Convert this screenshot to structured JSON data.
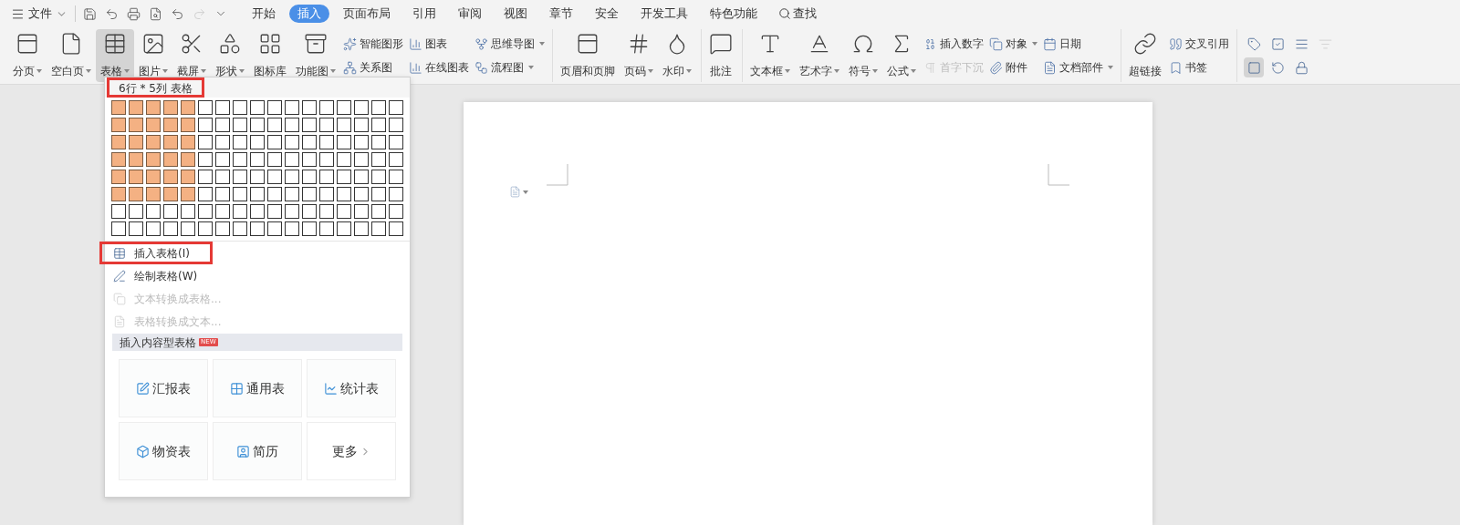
{
  "menu": {
    "file": "文件",
    "tabs": [
      {
        "label": "开始",
        "selected": false
      },
      {
        "label": "插入",
        "selected": true
      },
      {
        "label": "页面布局",
        "selected": false
      },
      {
        "label": "引用",
        "selected": false
      },
      {
        "label": "审阅",
        "selected": false
      },
      {
        "label": "视图",
        "selected": false
      },
      {
        "label": "章节",
        "selected": false
      },
      {
        "label": "安全",
        "selected": false
      },
      {
        "label": "开发工具",
        "selected": false
      },
      {
        "label": "特色功能",
        "selected": false
      }
    ],
    "search": "查找"
  },
  "ribbon": {
    "groups": [
      {
        "items": [
          {
            "kind": "large",
            "label": "分页",
            "dropdown": true,
            "selected": false
          },
          {
            "kind": "large",
            "label": "空白页",
            "dropdown": true,
            "selected": false
          },
          {
            "kind": "large",
            "label": "表格",
            "dropdown": true,
            "selected": true
          },
          {
            "kind": "large",
            "label": "图片",
            "dropdown": true,
            "selected": false
          },
          {
            "kind": "large",
            "label": "截屏",
            "dropdown": true,
            "selected": false
          },
          {
            "kind": "large",
            "label": "形状",
            "dropdown": true,
            "selected": false
          },
          {
            "kind": "large",
            "label": "图标库",
            "dropdown": false,
            "selected": false
          },
          {
            "kind": "large",
            "label": "功能图",
            "dropdown": true,
            "selected": false
          },
          {
            "kind": "stack",
            "buttons": [
              {
                "label": "智能图形",
                "dropdown": false,
                "disabled": false
              },
              {
                "label": "关系图",
                "dropdown": false,
                "disabled": false
              }
            ]
          },
          {
            "kind": "stack",
            "buttons": [
              {
                "label": "图表",
                "dropdown": false,
                "disabled": false
              },
              {
                "label": "在线图表",
                "dropdown": false,
                "disabled": false
              }
            ]
          },
          {
            "kind": "stack",
            "buttons": [
              {
                "label": "思维导图",
                "dropdown": true,
                "disabled": false
              },
              {
                "label": "流程图",
                "dropdown": true,
                "disabled": false
              }
            ]
          }
        ]
      },
      {
        "items": [
          {
            "kind": "large",
            "label": "页眉和页脚",
            "dropdown": false,
            "selected": false
          },
          {
            "kind": "large",
            "label": "页码",
            "dropdown": true,
            "selected": false
          },
          {
            "kind": "large",
            "label": "水印",
            "dropdown": true,
            "selected": false
          }
        ]
      },
      {
        "items": [
          {
            "kind": "large",
            "label": "批注",
            "dropdown": false,
            "selected": false
          }
        ]
      },
      {
        "items": [
          {
            "kind": "large",
            "label": "文本框",
            "dropdown": true,
            "selected": false
          },
          {
            "kind": "large",
            "label": "艺术字",
            "dropdown": true,
            "selected": false
          },
          {
            "kind": "large",
            "label": "符号",
            "dropdown": true,
            "selected": false
          },
          {
            "kind": "large",
            "label": "公式",
            "dropdown": true,
            "selected": false
          },
          {
            "kind": "stack",
            "buttons": [
              {
                "label": "插入数字",
                "dropdown": false,
                "disabled": false
              },
              {
                "label": "首字下沉",
                "dropdown": false,
                "disabled": true
              }
            ]
          },
          {
            "kind": "stack",
            "buttons": [
              {
                "label": "对象",
                "dropdown": true,
                "disabled": false
              },
              {
                "label": "附件",
                "dropdown": false,
                "disabled": false
              }
            ]
          },
          {
            "kind": "stack",
            "buttons": [
              {
                "label": "日期",
                "dropdown": false,
                "disabled": false
              },
              {
                "label": "文档部件",
                "dropdown": true,
                "disabled": false
              }
            ]
          }
        ]
      },
      {
        "items": [
          {
            "kind": "large",
            "label": "超链接",
            "dropdown": false,
            "selected": false
          },
          {
            "kind": "stack",
            "buttons": [
              {
                "label": "交叉引用",
                "dropdown": false,
                "disabled": false
              },
              {
                "label": "书签",
                "dropdown": false,
                "disabled": false
              }
            ]
          }
        ]
      },
      {
        "items": [
          {
            "kind": "icon_grid",
            "rows": [
              [
                {
                  "selected": false,
                  "disabled": false
                },
                {
                  "selected": false,
                  "disabled": false
                },
                {
                  "selected": false,
                  "disabled": false
                },
                {
                  "selected": false,
                  "disabled": true
                }
              ],
              [
                {
                  "selected": true,
                  "disabled": false
                },
                {
                  "selected": false,
                  "disabled": false
                },
                {
                  "selected": false,
                  "disabled": false
                }
              ]
            ]
          }
        ]
      }
    ]
  },
  "table_menu": {
    "size_label": {
      "text": "6行 * 5列 表格",
      "highlighted": true
    },
    "grid": [
      {
        "cells": [
          {
            "selected": true
          },
          {
            "selected": true
          },
          {
            "selected": true
          },
          {
            "selected": true
          },
          {
            "selected": true
          },
          {
            "selected": false
          },
          {
            "selected": false
          },
          {
            "selected": false
          },
          {
            "selected": false
          },
          {
            "selected": false
          },
          {
            "selected": false
          },
          {
            "selected": false
          },
          {
            "selected": false
          },
          {
            "selected": false
          },
          {
            "selected": false
          },
          {
            "selected": false
          },
          {
            "selected": false
          }
        ]
      },
      {
        "cells": [
          {
            "selected": true
          },
          {
            "selected": true
          },
          {
            "selected": true
          },
          {
            "selected": true
          },
          {
            "selected": true
          },
          {
            "selected": false
          },
          {
            "selected": false
          },
          {
            "selected": false
          },
          {
            "selected": false
          },
          {
            "selected": false
          },
          {
            "selected": false
          },
          {
            "selected": false
          },
          {
            "selected": false
          },
          {
            "selected": false
          },
          {
            "selected": false
          },
          {
            "selected": false
          },
          {
            "selected": false
          }
        ]
      },
      {
        "cells": [
          {
            "selected": true
          },
          {
            "selected": true
          },
          {
            "selected": true
          },
          {
            "selected": true
          },
          {
            "selected": true
          },
          {
            "selected": false
          },
          {
            "selected": false
          },
          {
            "selected": false
          },
          {
            "selected": false
          },
          {
            "selected": false
          },
          {
            "selected": false
          },
          {
            "selected": false
          },
          {
            "selected": false
          },
          {
            "selected": false
          },
          {
            "selected": false
          },
          {
            "selected": false
          },
          {
            "selected": false
          }
        ]
      },
      {
        "cells": [
          {
            "selected": true
          },
          {
            "selected": true
          },
          {
            "selected": true
          },
          {
            "selected": true
          },
          {
            "selected": true
          },
          {
            "selected": false
          },
          {
            "selected": false
          },
          {
            "selected": false
          },
          {
            "selected": false
          },
          {
            "selected": false
          },
          {
            "selected": false
          },
          {
            "selected": false
          },
          {
            "selected": false
          },
          {
            "selected": false
          },
          {
            "selected": false
          },
          {
            "selected": false
          },
          {
            "selected": false
          }
        ]
      },
      {
        "cells": [
          {
            "selected": true
          },
          {
            "selected": true
          },
          {
            "selected": true
          },
          {
            "selected": true
          },
          {
            "selected": true
          },
          {
            "selected": false
          },
          {
            "selected": false
          },
          {
            "selected": false
          },
          {
            "selected": false
          },
          {
            "selected": false
          },
          {
            "selected": false
          },
          {
            "selected": false
          },
          {
            "selected": false
          },
          {
            "selected": false
          },
          {
            "selected": false
          },
          {
            "selected": false
          },
          {
            "selected": false
          }
        ]
      },
      {
        "cells": [
          {
            "selected": true
          },
          {
            "selected": true
          },
          {
            "selected": true
          },
          {
            "selected": true
          },
          {
            "selected": true
          },
          {
            "selected": false
          },
          {
            "selected": false
          },
          {
            "selected": false
          },
          {
            "selected": false
          },
          {
            "selected": false
          },
          {
            "selected": false
          },
          {
            "selected": false
          },
          {
            "selected": false
          },
          {
            "selected": false
          },
          {
            "selected": false
          },
          {
            "selected": false
          },
          {
            "selected": false
          }
        ]
      },
      {
        "cells": [
          {
            "selected": false
          },
          {
            "selected": false
          },
          {
            "selected": false
          },
          {
            "selected": false
          },
          {
            "selected": false
          },
          {
            "selected": false
          },
          {
            "selected": false
          },
          {
            "selected": false
          },
          {
            "selected": false
          },
          {
            "selected": false
          },
          {
            "selected": false
          },
          {
            "selected": false
          },
          {
            "selected": false
          },
          {
            "selected": false
          },
          {
            "selected": false
          },
          {
            "selected": false
          },
          {
            "selected": false
          }
        ]
      },
      {
        "cells": [
          {
            "selected": false
          },
          {
            "selected": false
          },
          {
            "selected": false
          },
          {
            "selected": false
          },
          {
            "selected": false
          },
          {
            "selected": false
          },
          {
            "selected": false
          },
          {
            "selected": false
          },
          {
            "selected": false
          },
          {
            "selected": false
          },
          {
            "selected": false
          },
          {
            "selected": false
          },
          {
            "selected": false
          },
          {
            "selected": false
          },
          {
            "selected": false
          },
          {
            "selected": false
          },
          {
            "selected": false
          }
        ]
      }
    ],
    "items": [
      {
        "label": "插入表格(I)",
        "disabled": false,
        "highlighted": true
      },
      {
        "label": "绘制表格(W)",
        "disabled": false,
        "highlighted": false
      },
      {
        "label": "文本转换成表格...",
        "disabled": true,
        "highlighted": false
      },
      {
        "label": "表格转换成文本...",
        "disabled": true,
        "highlighted": false
      }
    ],
    "section": {
      "title": "插入内容型表格",
      "badge": "NEW"
    },
    "templates": [
      {
        "kind": "template",
        "label": "汇报表"
      },
      {
        "kind": "template",
        "label": "通用表"
      },
      {
        "kind": "template",
        "label": "统计表"
      },
      {
        "kind": "template",
        "label": "物资表"
      },
      {
        "kind": "template",
        "label": "简历"
      },
      {
        "kind": "more",
        "label": "更多"
      }
    ]
  }
}
